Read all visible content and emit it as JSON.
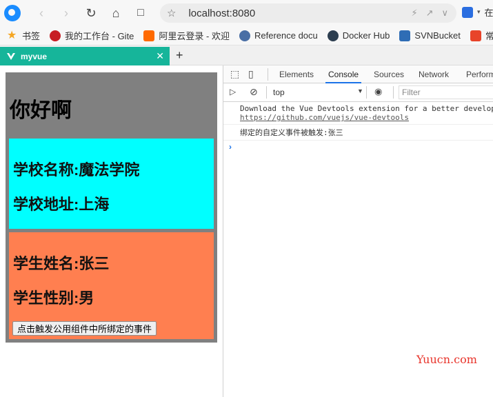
{
  "toolbar": {
    "url": "localhost:8080",
    "overflow_text": "在"
  },
  "bookmarks": [
    {
      "label": "书签",
      "color": "#f5a623"
    },
    {
      "label": "我的工作台 - Gite",
      "color": "#c71d23"
    },
    {
      "label": "阿里云登录 - 欢迎",
      "color": "#ff6a00"
    },
    {
      "label": "Reference docu",
      "color": "#4a6fa5"
    },
    {
      "label": "Docker Hub",
      "color": "#2d3e50"
    },
    {
      "label": "SVNBucket",
      "color": "#2f6db5"
    },
    {
      "label": "常",
      "color": "#e8442a"
    }
  ],
  "tab": {
    "title": "myvue",
    "color": "#16b59a"
  },
  "page": {
    "heading": "你好啊",
    "school_name": "学校名称:魔法学院",
    "school_address": "学校地址:上海",
    "student_name": "学生姓名:张三",
    "student_gender": "学生性别:男",
    "button_label": "点击触发公用组件中所绑定的事件"
  },
  "devtools": {
    "tabs": [
      "Elements",
      "Console",
      "Sources",
      "Network",
      "Perform"
    ],
    "active_tab": "Console",
    "context": "top",
    "filter_placeholder": "Filter",
    "messages": {
      "devtools_notice": "Download the Vue Devtools extension for a better develop",
      "devtools_link": "https://github.com/vuejs/vue-devtools",
      "event_log": "绑定的自定义事件被触发:张三"
    }
  },
  "watermark": "Yuucn.com"
}
